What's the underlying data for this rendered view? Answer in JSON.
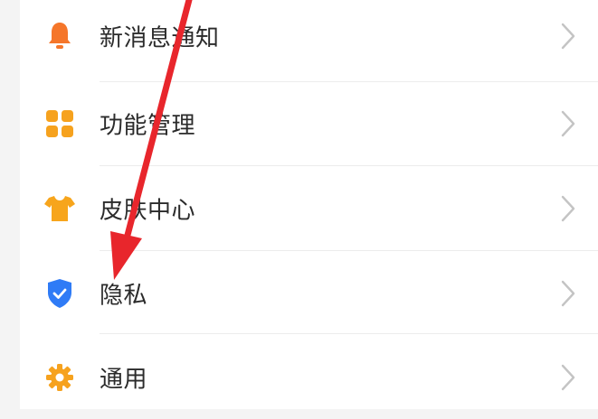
{
  "settings": {
    "items": [
      {
        "label": "新消息通知",
        "icon": "bell-icon",
        "icon_color": "#f5762a"
      },
      {
        "label": "功能管理",
        "icon": "grid-apps-icon",
        "icon_color": "#f6a21e"
      },
      {
        "label": "皮肤中心",
        "icon": "tshirt-icon",
        "icon_color": "#f7a51c"
      },
      {
        "label": "隐私",
        "icon": "shield-check-icon",
        "icon_color": "#2f7bf6"
      },
      {
        "label": "通用",
        "icon": "gear-icon",
        "icon_color": "#f6a21e"
      }
    ]
  },
  "annotation": {
    "type": "red-arrow",
    "color": "#e8262c",
    "points_to": "隐私"
  },
  "colors": {
    "chevron": "#c4c4c4",
    "divider": "#ececec",
    "text": "#2b2b2b"
  }
}
